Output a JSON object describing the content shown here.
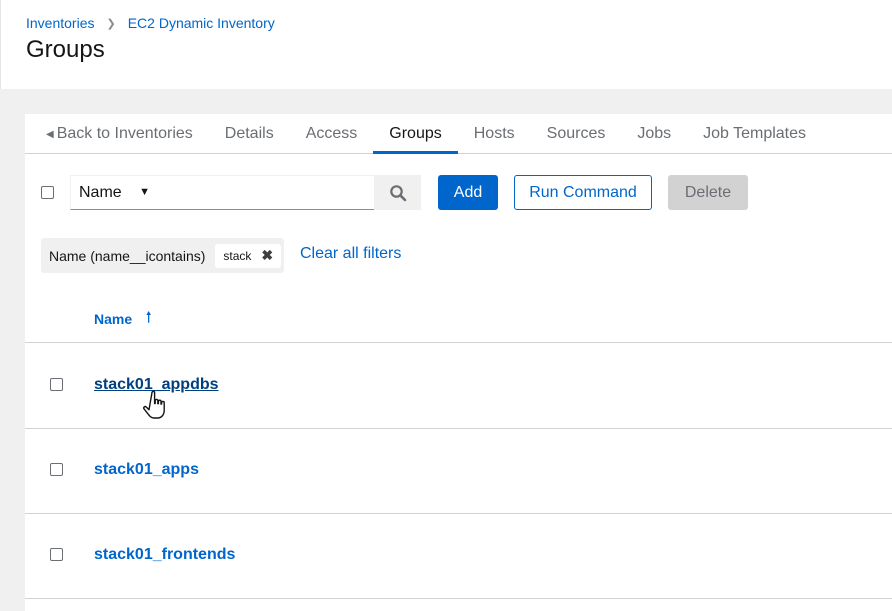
{
  "breadcrumb": {
    "items": [
      "Inventories",
      "EC2 Dynamic Inventory"
    ],
    "separator": "›"
  },
  "page_title": "Groups",
  "tabs": [
    {
      "label": "Back to Inventories",
      "icon": "caret-left-icon"
    },
    {
      "label": "Details"
    },
    {
      "label": "Access"
    },
    {
      "label": "Groups",
      "active": true
    },
    {
      "label": "Hosts"
    },
    {
      "label": "Sources"
    },
    {
      "label": "Jobs"
    },
    {
      "label": "Job Templates"
    }
  ],
  "toolbar": {
    "search_field": "Name",
    "search_value": "",
    "search_icon": "search-icon",
    "add_label": "Add",
    "run_command_label": "Run Command",
    "delete_label": "Delete"
  },
  "filters": {
    "group_label": "Name (name__icontains)",
    "chips": [
      "stack"
    ],
    "clear_label": "Clear all filters"
  },
  "table": {
    "column_header": "Name",
    "sort": "ascending",
    "rows": [
      {
        "name": "stack01_appdbs",
        "hovered": true
      },
      {
        "name": "stack01_apps"
      },
      {
        "name": "stack01_frontends"
      }
    ]
  },
  "colors": {
    "primary": "#0066cc",
    "text": "#151515",
    "muted": "#6a6e73",
    "background": "#f0f0f0"
  }
}
